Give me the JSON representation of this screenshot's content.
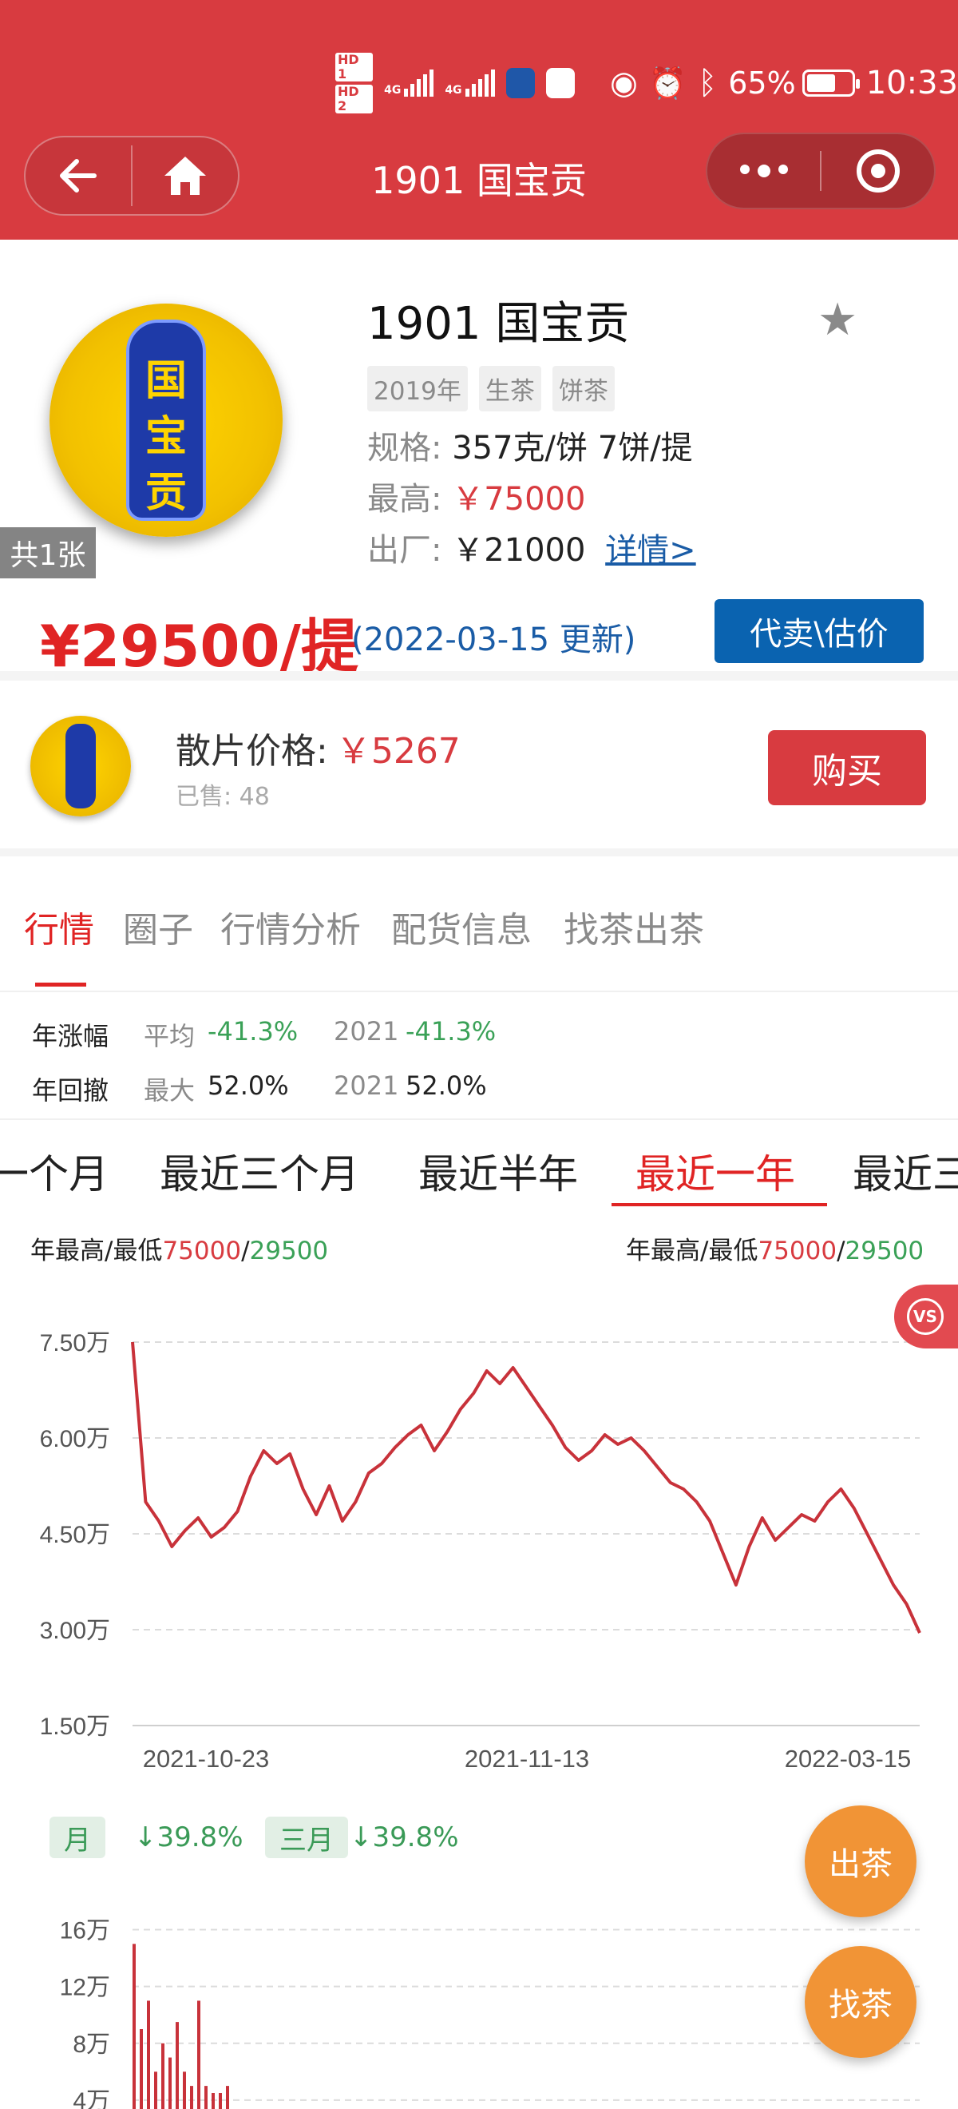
{
  "status_bar": {
    "battery": "65%",
    "time": "10:33",
    "hd1": "HD 1",
    "hd2": "HD 2",
    "net": "4G"
  },
  "nav": {
    "title": "1901 国宝贡"
  },
  "product": {
    "name": "1901 国宝贡",
    "image_count": "共1张",
    "tags": [
      "2019年",
      "生茶",
      "饼茶"
    ],
    "spec_label": "规格:",
    "spec_value": "357克/饼 7饼/提",
    "high_label": "最高:",
    "high_value": "￥75000",
    "factory_label": "出厂:",
    "factory_value": "￥21000",
    "details_link": "详情>",
    "price": "¥29500/提",
    "update": "(2022-03-15 更新)",
    "consign_label": "代卖\\估价"
  },
  "loose": {
    "label": "散片价格:",
    "price": "￥5267",
    "sold": "已售: 48",
    "buy_label": "购买"
  },
  "tabs": [
    "行情",
    "圈子",
    "行情分析",
    "配货信息",
    "找茶出茶"
  ],
  "stats": {
    "row1": {
      "label": "年涨幅",
      "avg_label": "平均",
      "avg": "-41.3%",
      "year": "2021",
      "year_val": "-41.3%"
    },
    "row2": {
      "label": "年回撤",
      "max_label": "最大",
      "max": "52.0%",
      "year": "2021",
      "year_val": "52.0%"
    }
  },
  "periods": [
    "一个月",
    "最近三个月",
    "最近半年",
    "最近一年",
    "最近三"
  ],
  "hilo": {
    "label": "年最高/最低",
    "high": "75000",
    "sep": "/",
    "low": "29500"
  },
  "vs_label": "VS",
  "changes": {
    "month_label": "月",
    "month_val": "↓39.8%",
    "quarter_label": "三月",
    "quarter_val": "↓39.8%"
  },
  "fab": {
    "sell": "出茶",
    "find": "找茶"
  },
  "colors": {
    "brand_red": "#d83b40",
    "price_red": "#e02424",
    "blue": "#0a63b0",
    "green": "#3aa157",
    "orange": "#f19436"
  },
  "chart_data": [
    {
      "type": "line",
      "ylabels": [
        "7.50万",
        "6.00万",
        "4.50万",
        "3.00万",
        "1.50万"
      ],
      "yticks": [
        75000,
        60000,
        45000,
        30000,
        15000
      ],
      "ylim": [
        15000,
        75000
      ],
      "xlabels": [
        "2021-10-23",
        "2021-11-13",
        "2022-03-15"
      ],
      "grid": true,
      "series": [
        {
          "values": [
            75000,
            50000,
            47000,
            43000,
            45500,
            47500,
            44500,
            46000,
            48500,
            54000,
            58000,
            56000,
            57500,
            52000,
            48000,
            52500,
            47000,
            50000,
            54500,
            56000,
            58500,
            60500,
            62000,
            58000,
            61000,
            64500,
            67000,
            70500,
            68500,
            71000,
            68000,
            65000,
            62000,
            58500,
            56500,
            58000,
            60500,
            59000,
            60000,
            58000,
            55500,
            53000,
            52000,
            50000,
            47000,
            42000,
            37000,
            43000,
            47500,
            44000,
            46000,
            48000,
            47000,
            50000,
            52000,
            49000,
            45000,
            41000,
            37000,
            34000,
            29500
          ]
        }
      ]
    },
    {
      "type": "bar",
      "ylabels": [
        "16万",
        "12万",
        "8万",
        "4万"
      ],
      "yticks": [
        160000,
        120000,
        80000,
        40000
      ],
      "ylim": [
        0,
        180000
      ],
      "grid": true,
      "series": [
        {
          "values": [
            150000,
            90000,
            110000,
            60000,
            80000,
            70000,
            95000,
            60000,
            50000,
            110000,
            50000,
            45000,
            45000,
            50000
          ]
        }
      ]
    }
  ]
}
